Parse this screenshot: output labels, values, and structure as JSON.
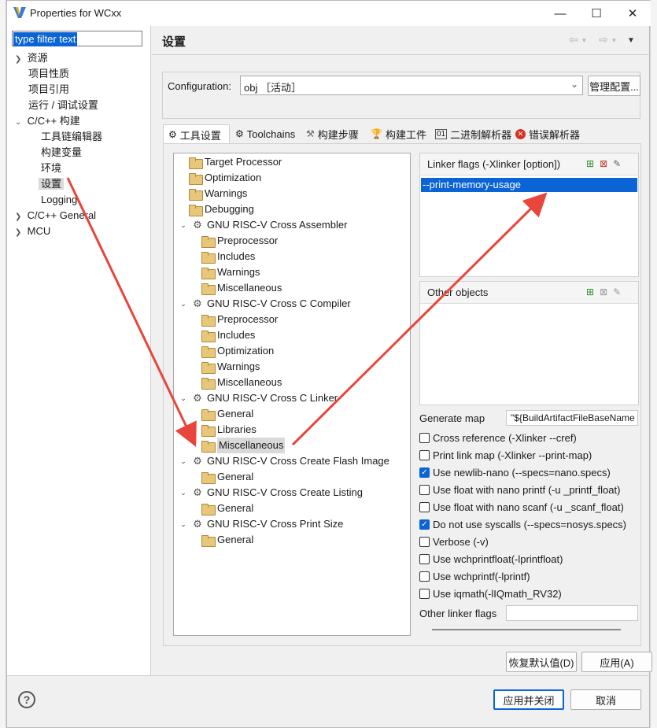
{
  "window": {
    "title": "Properties for WCxx"
  },
  "filter": {
    "value": "type filter text"
  },
  "left_tree": {
    "items": [
      {
        "label": "资源",
        "expander": "›"
      },
      {
        "label": "项目性质"
      },
      {
        "label": "项目引用"
      },
      {
        "label": "运行 / 调试设置"
      },
      {
        "label": "C/C++ 构建",
        "expander": "⌄"
      },
      {
        "label": "工具链编辑器"
      },
      {
        "label": "构建变量"
      },
      {
        "label": "环境"
      },
      {
        "label": "设置",
        "selected": true
      },
      {
        "label": "Logging"
      },
      {
        "label": "C/C++ General",
        "expander": "›"
      },
      {
        "label": "MCU",
        "expander": "›"
      }
    ]
  },
  "page": {
    "title": "设置"
  },
  "configuration": {
    "label": "Configuration:",
    "value": "obj ［活动］",
    "manage_button": "管理配置..."
  },
  "tabs": [
    {
      "label": "工具设置",
      "icon": "gear-icon",
      "active": true
    },
    {
      "label": "Toolchains",
      "icon": "gear-icon"
    },
    {
      "label": "构建步骤",
      "icon": "hammer-icon"
    },
    {
      "label": "构建工件",
      "icon": "trophy-icon"
    },
    {
      "label": "二进制解析器",
      "icon": "binary-icon"
    },
    {
      "label": "错误解析器",
      "icon": "error-icon"
    }
  ],
  "tool_tree": {
    "nodes": [
      {
        "label": "Target Processor",
        "level": 0,
        "kind": "folder"
      },
      {
        "label": "Optimization",
        "level": 0,
        "kind": "folder"
      },
      {
        "label": "Warnings",
        "level": 0,
        "kind": "folder"
      },
      {
        "label": "Debugging",
        "level": 0,
        "kind": "folder"
      },
      {
        "label": "GNU RISC-V Cross Assembler",
        "level": 0,
        "kind": "tool"
      },
      {
        "label": "Preprocessor",
        "level": 1,
        "kind": "folder"
      },
      {
        "label": "Includes",
        "level": 1,
        "kind": "folder"
      },
      {
        "label": "Warnings",
        "level": 1,
        "kind": "folder"
      },
      {
        "label": "Miscellaneous",
        "level": 1,
        "kind": "folder"
      },
      {
        "label": "GNU RISC-V Cross C Compiler",
        "level": 0,
        "kind": "tool"
      },
      {
        "label": "Preprocessor",
        "level": 1,
        "kind": "folder"
      },
      {
        "label": "Includes",
        "level": 1,
        "kind": "folder"
      },
      {
        "label": "Optimization",
        "level": 1,
        "kind": "folder"
      },
      {
        "label": "Warnings",
        "level": 1,
        "kind": "folder"
      },
      {
        "label": "Miscellaneous",
        "level": 1,
        "kind": "folder"
      },
      {
        "label": "GNU RISC-V Cross C Linker",
        "level": 0,
        "kind": "tool"
      },
      {
        "label": "General",
        "level": 1,
        "kind": "folder"
      },
      {
        "label": "Libraries",
        "level": 1,
        "kind": "folder"
      },
      {
        "label": "Miscellaneous",
        "level": 1,
        "kind": "folder",
        "selected": true
      },
      {
        "label": "GNU RISC-V Cross Create Flash Image",
        "level": 0,
        "kind": "tool"
      },
      {
        "label": "General",
        "level": 1,
        "kind": "folder"
      },
      {
        "label": "GNU RISC-V Cross Create Listing",
        "level": 0,
        "kind": "tool"
      },
      {
        "label": "General",
        "level": 1,
        "kind": "folder"
      },
      {
        "label": "GNU RISC-V Cross Print Size",
        "level": 0,
        "kind": "tool"
      },
      {
        "label": "General",
        "level": 1,
        "kind": "folder"
      }
    ]
  },
  "linker_flags": {
    "label": "Linker flags (-Xlinker [option])",
    "items": [
      "--print-memory-usage"
    ]
  },
  "other_objects": {
    "label": "Other objects"
  },
  "generate_map": {
    "label": "Generate map",
    "value": "\"${BuildArtifactFileBaseName"
  },
  "options": [
    {
      "label": "Cross reference (-Xlinker --cref)",
      "checked": false
    },
    {
      "label": "Print link map (-Xlinker --print-map)",
      "checked": false
    },
    {
      "label": "Use newlib-nano (--specs=nano.specs)",
      "checked": true
    },
    {
      "label": "Use float with nano printf (-u _printf_float)",
      "checked": false
    },
    {
      "label": "Use float with nano scanf (-u _scanf_float)",
      "checked": false
    },
    {
      "label": "Do not use syscalls (--specs=nosys.specs)",
      "checked": true
    },
    {
      "label": "Verbose (-v)",
      "checked": false
    },
    {
      "label": "Use wchprintfloat(-lprintfloat)",
      "checked": false
    },
    {
      "label": "Use wchprintf(-lprintf)",
      "checked": false
    },
    {
      "label": "Use iqmath(-lIQmath_RV32)",
      "checked": false
    }
  ],
  "other_linker_flags": {
    "label": "Other linker flags",
    "value": ""
  },
  "buttons": {
    "restore_defaults": "恢复默认值(D)",
    "apply": "应用(A)",
    "apply_close": "应用并关闭",
    "cancel": "取消"
  },
  "colors": {
    "accent": "#0a64d6",
    "annotation_arrow": "#e8453c"
  }
}
